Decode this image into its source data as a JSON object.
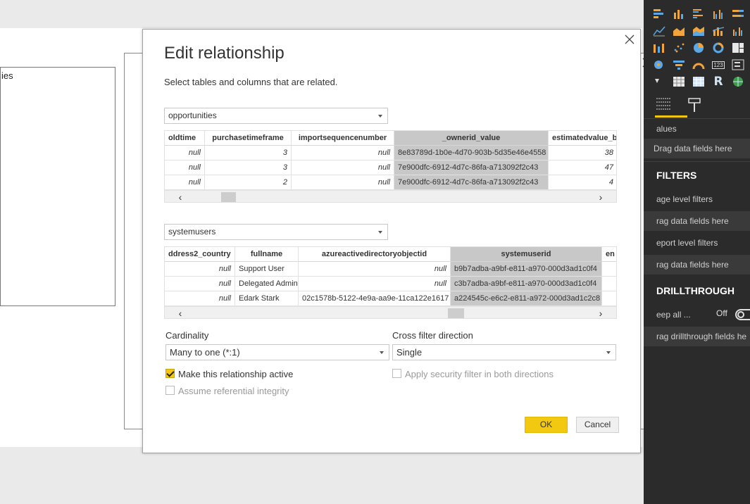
{
  "canvas": {
    "visual_text": "ies"
  },
  "right_pane": {
    "fields": {
      "values_label": "alues",
      "values_placeholder": "Drag data fields here"
    },
    "filters": {
      "header": "FILTERS",
      "page_level": "age level filters",
      "page_placeholder": "rag data fields here",
      "report_level": "eport level filters",
      "report_placeholder": "rag data fields here"
    },
    "drillthrough": {
      "header": "DRILLTHROUGH",
      "keep_all": "eep all ...",
      "toggle_label": "Off",
      "placeholder": "rag drillthrough fields he"
    },
    "r_visual": "R",
    "number_visual": "123"
  },
  "dialog": {
    "title": "Edit relationship",
    "subtitle": "Select tables and columns that are related.",
    "table1": {
      "selected": "opportunities",
      "columns": [
        "oldtime",
        "purchasetimeframe",
        "importsequencenumber",
        "_ownerid_value",
        "estimatedvalue_ba"
      ],
      "rows": [
        [
          "null",
          "3",
          "null",
          "8e83789d-1b0e-4d70-903b-5d35e46e4558",
          "38"
        ],
        [
          "null",
          "3",
          "null",
          "7e900dfc-6912-4d7c-86fa-a713092f2c43",
          "47"
        ],
        [
          "null",
          "2",
          "null",
          "7e900dfc-6912-4d7c-86fa-a713092f2c43",
          "4"
        ]
      ]
    },
    "table2": {
      "selected": "systemusers",
      "columns": [
        "ddress2_country",
        "fullname",
        "azureactivedirectoryobjectid",
        "systemuserid",
        "en"
      ],
      "rows": [
        [
          "null",
          "Support User",
          "null",
          "b9b7adba-a9bf-e811-a970-000d3ad1c0f4",
          ""
        ],
        [
          "null",
          "Delegated Admin",
          "null",
          "c3b7adba-a9bf-e811-a970-000d3ad1c0f4",
          ""
        ],
        [
          "null",
          "Edark Stark",
          "02c1578b-5122-4e9a-aa9e-11ca122e1617",
          "a224545c-e6c2-e811-a972-000d3ad1c2c8",
          ""
        ]
      ]
    },
    "cardinality": {
      "label": "Cardinality",
      "selected": "Many to one (*:1)"
    },
    "cross_filter": {
      "label": "Cross filter direction",
      "selected": "Single"
    },
    "make_active": {
      "label": "Make this relationship active",
      "checked": true
    },
    "security_filter": {
      "label": "Apply security filter in both directions",
      "checked": false
    },
    "referential_integrity": {
      "label": "Assume referential integrity",
      "checked": false
    },
    "ok_label": "OK",
    "cancel_label": "Cancel"
  },
  "colors": {
    "accent": "#f2c811",
    "pane_bg": "#2b2b2b",
    "selected_column": "#c8c8c8"
  }
}
